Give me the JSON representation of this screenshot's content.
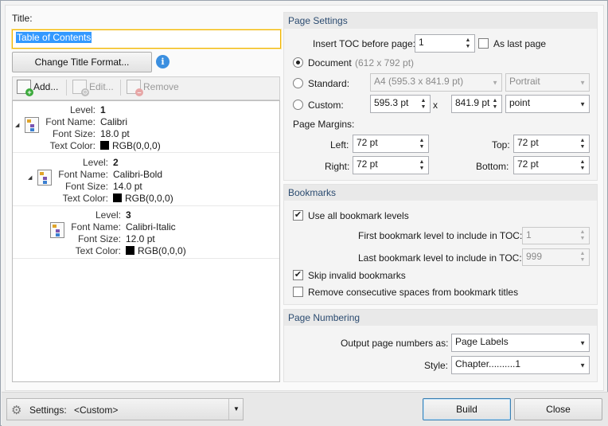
{
  "title_label": "Title:",
  "title_value": "Table of Contents",
  "change_title_format": "Change Title Format...",
  "info_icon": "i",
  "toolbar": {
    "add": "Add...",
    "edit": "Edit...",
    "remove": "Remove"
  },
  "level_keys": {
    "level": "Level:",
    "font_name": "Font Name:",
    "font_size": "Font Size:",
    "text_color": "Text Color:"
  },
  "levels": [
    {
      "level": "1",
      "font_name": "Calibri",
      "font_size": "18.0 pt",
      "text_color": "RGB(0,0,0)"
    },
    {
      "level": "2",
      "font_name": "Calibri-Bold",
      "font_size": "14.0 pt",
      "text_color": "RGB(0,0,0)"
    },
    {
      "level": "3",
      "font_name": "Calibri-Italic",
      "font_size": "12.0 pt",
      "text_color": "RGB(0,0,0)"
    }
  ],
  "page_settings": {
    "heading": "Page Settings",
    "insert_toc_label": "Insert TOC before page:",
    "insert_toc_value": "1",
    "as_last_page": "As last page",
    "document_label": "Document",
    "document_size": "(612 x 792 pt)",
    "standard_label": "Standard:",
    "standard_value": "A4 (595.3 x 841.9 pt)",
    "orientation_value": "Portrait",
    "custom_label": "Custom:",
    "custom_width": "595.3 pt",
    "custom_x": "x",
    "custom_height": "841.9 pt",
    "custom_unit": "point",
    "margins_label": "Page Margins:",
    "left_label": "Left:",
    "left_value": "72 pt",
    "top_label": "Top:",
    "top_value": "72 pt",
    "right_label": "Right:",
    "right_value": "72 pt",
    "bottom_label": "Bottom:",
    "bottom_value": "72 pt"
  },
  "bookmarks": {
    "heading": "Bookmarks",
    "use_all_levels": "Use all bookmark levels",
    "first_level_label": "First bookmark level to include in TOC:",
    "first_level_value": "1",
    "last_level_label": "Last bookmark level to include in TOC:",
    "last_level_value": "999",
    "skip_invalid": "Skip invalid bookmarks",
    "remove_spaces": "Remove consecutive spaces from bookmark titles",
    "check_mark": "✔"
  },
  "page_numbering": {
    "heading": "Page Numbering",
    "output_label": "Output page numbers as:",
    "output_value": "Page Labels",
    "style_label": "Style:",
    "style_value": "Chapter..........1"
  },
  "footer": {
    "settings_label": "Settings:",
    "settings_value": "<Custom>",
    "build": "Build",
    "close": "Close"
  }
}
